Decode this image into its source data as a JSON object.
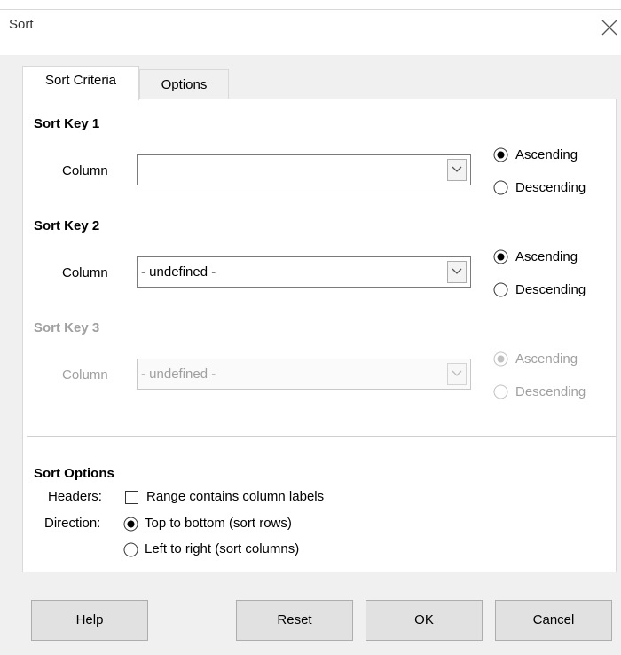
{
  "window": {
    "title": "Sort",
    "close_icon": "close-icon"
  },
  "tabs": [
    {
      "label": "Sort Criteria",
      "active": true
    },
    {
      "label": "Options",
      "active": false
    }
  ],
  "sort_keys": [
    {
      "heading": "Sort Key 1",
      "column_label": "Column",
      "column_value": "",
      "ascending": "Ascending",
      "descending": "Descending",
      "selected": "Ascending",
      "enabled": true
    },
    {
      "heading": "Sort Key 2",
      "column_label": "Column",
      "column_value": "- undefined -",
      "ascending": "Ascending",
      "descending": "Descending",
      "selected": "Ascending",
      "enabled": true
    },
    {
      "heading": "Sort Key 3",
      "column_label": "Column",
      "column_value": "- undefined -",
      "ascending": "Ascending",
      "descending": "Descending",
      "selected": "Ascending",
      "enabled": false
    }
  ],
  "sort_options": {
    "heading": "Sort Options",
    "headers_label": "Headers:",
    "headers_checkbox_label": "Range contains column labels",
    "headers_checked": false,
    "direction_label": "Direction:",
    "top_to_bottom": "Top to bottom (sort rows)",
    "left_to_right": "Left to right (sort columns)",
    "direction_selected": "Top to bottom (sort rows)"
  },
  "buttons": {
    "help": "Help",
    "reset": "Reset",
    "ok": "OK",
    "cancel": "Cancel"
  },
  "colors": {
    "dialog_bg": "#f0f0f0",
    "panel_bg": "#ffffff",
    "disabled_text": "#a0a0a0"
  }
}
